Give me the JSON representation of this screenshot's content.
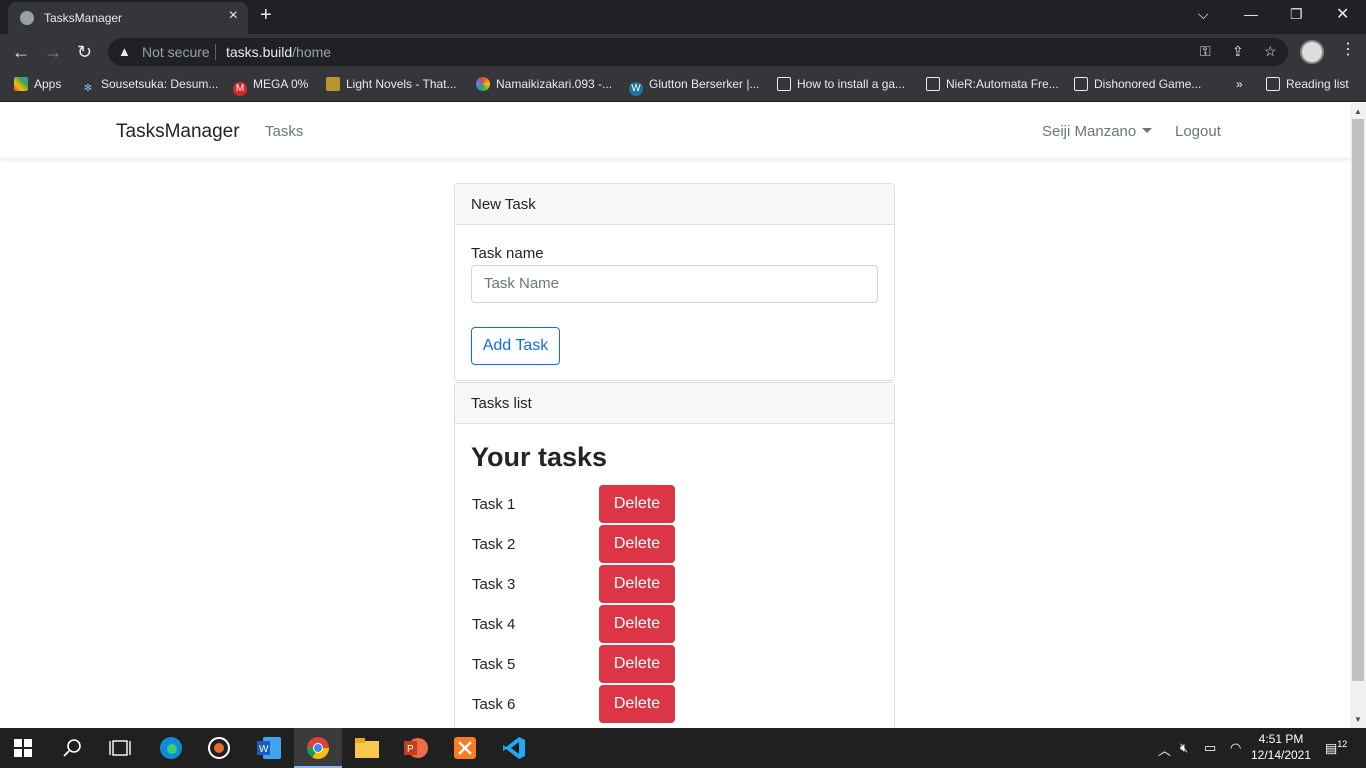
{
  "browser": {
    "tab_title": "TasksManager",
    "close_tab_glyph": "×",
    "new_tab_glyph": "+",
    "address_security": "Not secure",
    "url_host": "tasks.build",
    "url_path": "/home",
    "bookmarks": [
      {
        "label": "Apps",
        "icon": "apps-grid-icon"
      },
      {
        "label": "Sousetsuka: Desum...",
        "icon": "snowflake-icon"
      },
      {
        "label": "MEGA 0%",
        "icon": "mega-icon"
      },
      {
        "label": "Light Novels - That...",
        "icon": "light-novels-icon"
      },
      {
        "label": "Namaikizakari.093 -...",
        "icon": "namaikizakari-icon"
      },
      {
        "label": "Glutton Berserker |...",
        "icon": "wordpress-icon"
      },
      {
        "label": "How to install a ga...",
        "icon": "page-icon"
      },
      {
        "label": "NieR:Automata Fre...",
        "icon": "page-icon"
      },
      {
        "label": "Dishonored Game...",
        "icon": "page-icon"
      }
    ],
    "overflow_glyph": "»",
    "reading_list": "Reading list"
  },
  "navbar": {
    "brand": "TasksManager",
    "tasks_link": "Tasks",
    "user": "Seiji Manzano",
    "logout": "Logout"
  },
  "new_task": {
    "header": "New Task",
    "label": "Task name",
    "placeholder": "Task Name",
    "button": "Add Task"
  },
  "tasks_list": {
    "header": "Tasks list",
    "heading": "Your tasks",
    "delete_label": "Delete",
    "tasks": [
      {
        "name": "Task 1"
      },
      {
        "name": "Task 2"
      },
      {
        "name": "Task 3"
      },
      {
        "name": "Task 4"
      },
      {
        "name": "Task 5"
      },
      {
        "name": "Task 6"
      }
    ]
  },
  "taskbar": {
    "time": "4:51 PM",
    "date": "12/14/2021",
    "notifications": "12"
  },
  "colors": {
    "primary": "#0d6efd",
    "danger": "#dc3545",
    "chrome_dark": "#202124",
    "chrome_mid": "#35363a"
  }
}
